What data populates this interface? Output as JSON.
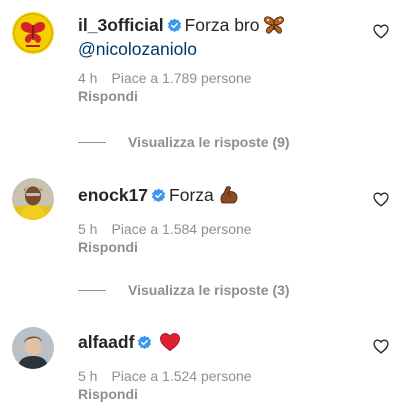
{
  "comments": [
    {
      "username": "il_3official",
      "verified": true,
      "text": "Forza bro",
      "emoji": "butterfly-emoji",
      "mention": "@nicolozaniolo",
      "time": "4 h",
      "likes": "Piace a 1.789 persone",
      "reply": "Rispondi",
      "view_replies": "Visualizza le risposte (9)"
    },
    {
      "username": "enock17",
      "verified": true,
      "text": "Forza",
      "emoji": "flexed-biceps-emoji",
      "time": "5 h",
      "likes": "Piace a 1.584 persone",
      "reply": "Rispondi",
      "view_replies": "Visualizza le risposte (3)"
    },
    {
      "username": "alfaadf",
      "verified": true,
      "text": "",
      "emoji": "red-heart-emoji",
      "time": "5 h",
      "likes": "Piace a 1.524 persone",
      "reply": "Rispondi"
    }
  ],
  "colors": {
    "text": "#262626",
    "secondary": "#8e8e8e",
    "mention": "#00376b",
    "verified": "#3897f0",
    "heart": "#ed4956"
  }
}
